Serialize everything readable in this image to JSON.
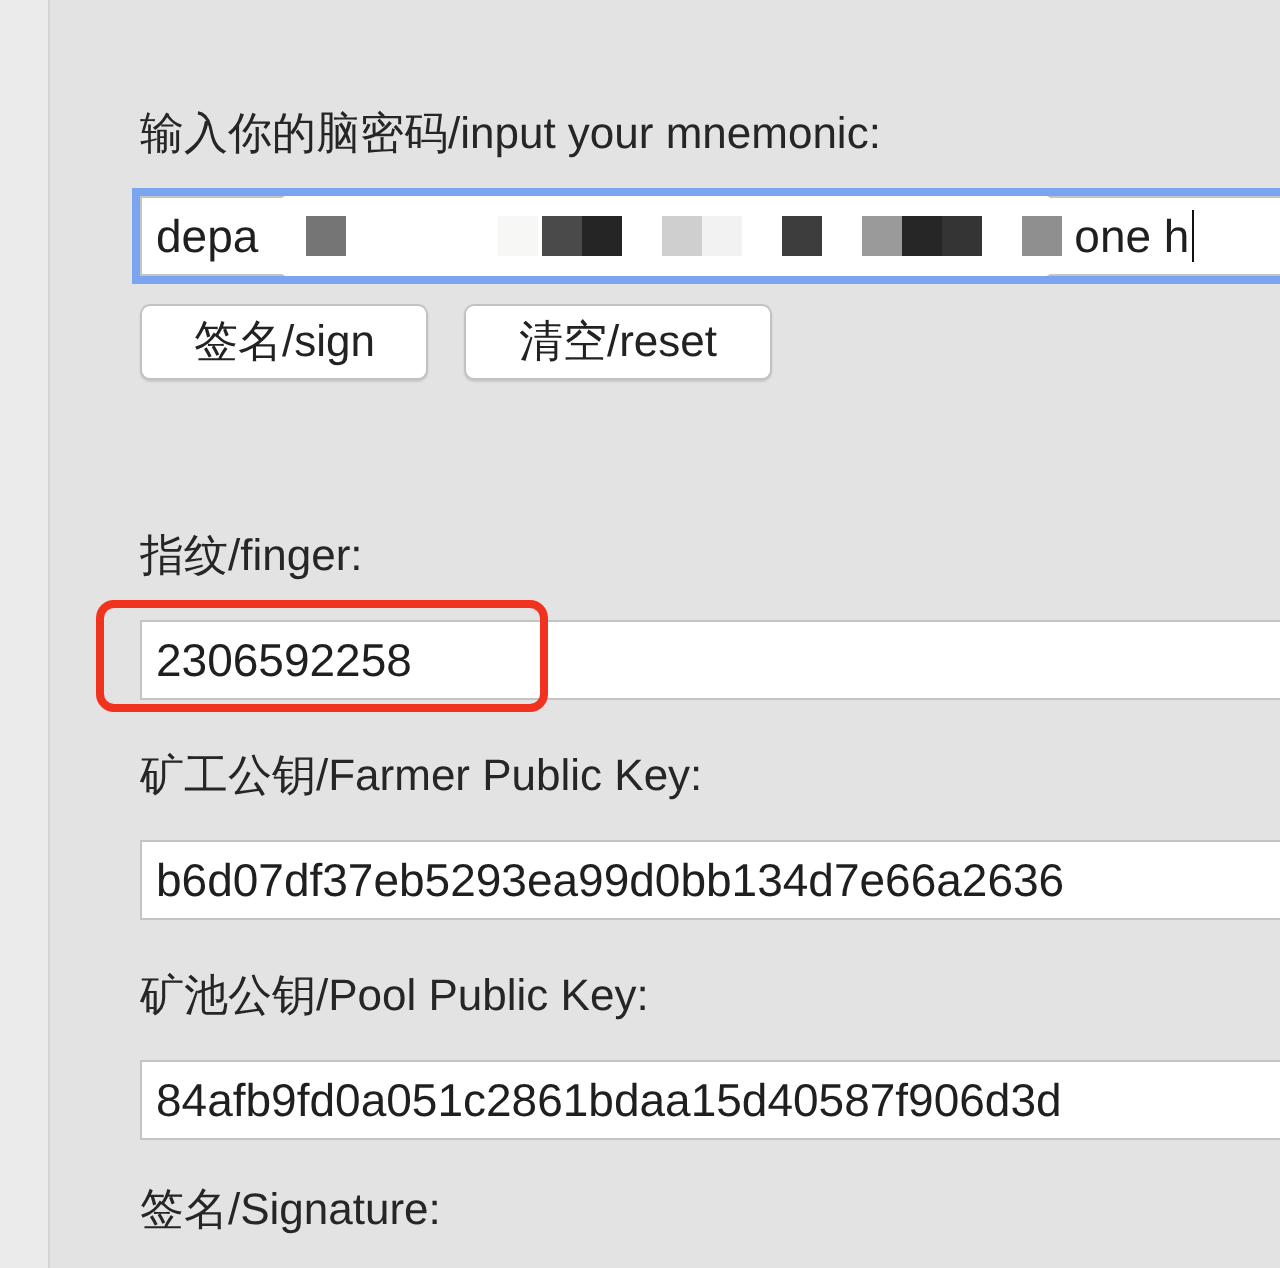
{
  "mnemonic": {
    "label": "输入你的脑密码/input your mnemonic:",
    "value_start": "depa",
    "value_end": "one h",
    "focused": true
  },
  "buttons": [
    {
      "label": "签名/sign"
    },
    {
      "label": "清空/reset"
    }
  ],
  "fields": [
    {
      "label": "指纹/finger:",
      "value": "2306592258",
      "highlighted": true
    },
    {
      "label": "矿工公钥/Farmer Public Key:",
      "value": "b6d07df37eb5293ea99d0bb134d7e66a2636",
      "highlighted": false
    },
    {
      "label": "矿池公钥/Pool Public Key:",
      "value": "84afb9fd0a051c2861bdaa15d40587f906d3d",
      "highlighted": false
    }
  ],
  "signature": {
    "label": "签名/Signature:"
  }
}
